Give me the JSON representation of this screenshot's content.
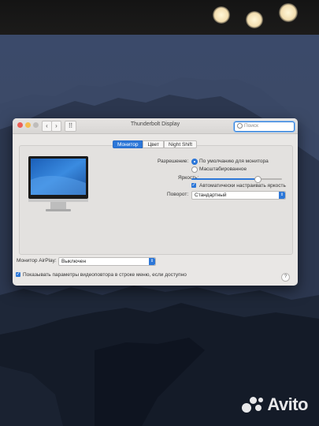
{
  "window": {
    "title": "Thunderbolt Display",
    "search_placeholder": "Поиск",
    "back_glyph": "‹",
    "forward_glyph": "›",
    "grid_glyph": "⠿"
  },
  "tabs": [
    {
      "label": "Монитор",
      "active": true
    },
    {
      "label": "Цвет",
      "active": false
    },
    {
      "label": "Night Shift",
      "active": false
    }
  ],
  "resolution": {
    "label": "Разрешение:",
    "options": [
      {
        "label": "По умолчанию для монитора",
        "selected": true
      },
      {
        "label": "Масштабированное",
        "selected": false
      }
    ]
  },
  "brightness": {
    "label": "Яркость:",
    "level": 0.73,
    "auto_label": "Автоматически настраивать яркость",
    "auto_checked": true
  },
  "rotation": {
    "label": "Поворот:",
    "value": "Стандартный"
  },
  "airplay": {
    "label": "Монитор AirPlay:",
    "value": "Выключен"
  },
  "mirroring": {
    "label": "Показывать параметры видеоповтора в строке меню, если доступно",
    "checked": true
  },
  "help_glyph": "?",
  "watermark": {
    "text": "Avito"
  },
  "colors": {
    "accent": "#2c77d8",
    "window_bg": "#e9e7e5",
    "close": "#ec5f56",
    "minimize": "#f4bd4f",
    "zoom": "#bfbdbb"
  }
}
